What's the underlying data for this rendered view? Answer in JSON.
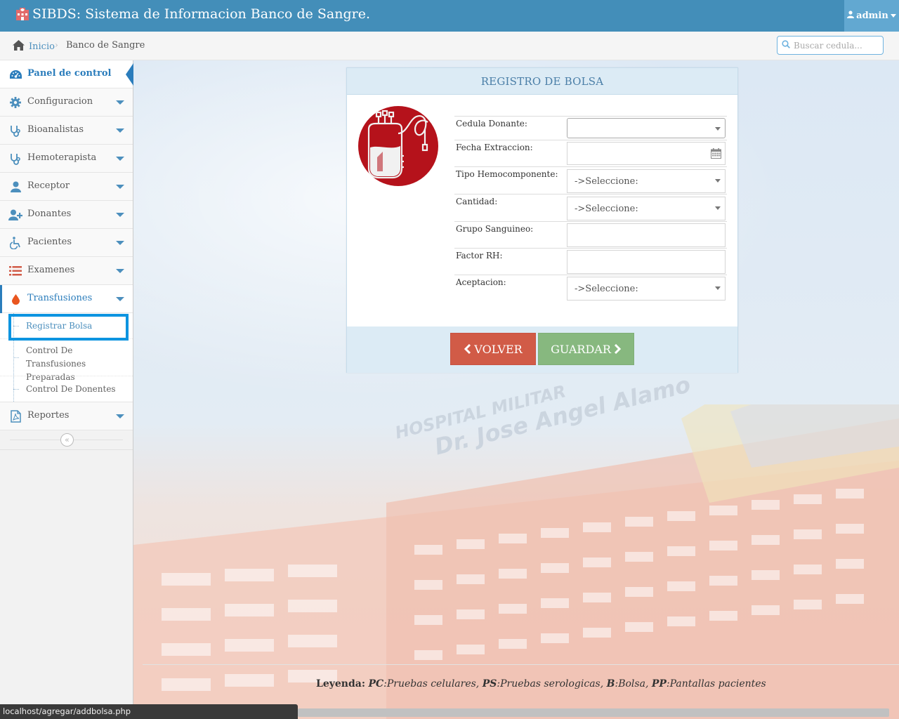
{
  "app": {
    "title": "SIBDS: Sistema de Informacion Banco de Sangre.",
    "user": "admin"
  },
  "breadcrumb": {
    "home": "Inicio",
    "current": "Banco de Sangre"
  },
  "search": {
    "placeholder": "Buscar cedula..."
  },
  "sidebar": {
    "items": [
      {
        "label": "Panel de control",
        "icon": "dashboard-icon"
      },
      {
        "label": "Configuracion",
        "icon": "gear-icon"
      },
      {
        "label": "Bioanalistas",
        "icon": "stethoscope-icon"
      },
      {
        "label": "Hemoterapista",
        "icon": "stethoscope-icon"
      },
      {
        "label": "Receptor",
        "icon": "user-icon"
      },
      {
        "label": "Donantes",
        "icon": "user-plus-icon"
      },
      {
        "label": "Pacientes",
        "icon": "wheelchair-icon"
      },
      {
        "label": "Examenes",
        "icon": "list-icon"
      },
      {
        "label": "Transfusiones",
        "icon": "blood-drop-icon"
      },
      {
        "label": "Reportes",
        "icon": "pdf-file-icon"
      }
    ],
    "submenu": [
      {
        "label": "Registrar Bolsa"
      },
      {
        "label": "Control De Transfusiones Preparadas"
      },
      {
        "label": "Control De Donentes"
      }
    ]
  },
  "form": {
    "title": "REGISTRO DE BOLSA",
    "fields": [
      {
        "label": "Cedula Donante:",
        "value": ""
      },
      {
        "label": "Fecha Extraccion:",
        "value": ""
      },
      {
        "label": "Tipo Hemocomponente:",
        "value": "->Seleccione:"
      },
      {
        "label": "Cantidad:",
        "value": "->Seleccione:"
      },
      {
        "label": "Grupo Sanguineo:",
        "value": ""
      },
      {
        "label": "Factor RH:",
        "value": ""
      },
      {
        "label": "Aceptacion:",
        "value": "->Seleccione:"
      }
    ],
    "buttons": {
      "back": "VOLVER",
      "save": "GUARDAR"
    }
  },
  "legend": {
    "title": "Leyenda:",
    "pc_code": "PC",
    "pc_text": ":Pruebas celulares, ",
    "ps_code": "PS",
    "ps_text": ":Pruebas serologicas, ",
    "b_code": "B",
    "b_text": ":Bolsa, ",
    "pp_code": "PP",
    "pp_text": ":Pantallas pacientes"
  },
  "background_sign": {
    "line1": "HOSPITAL MILITAR",
    "line2": "Dr. Jose Angel Alamo"
  },
  "status_bar": {
    "url": "localhost/agregar/addbolsa.php"
  },
  "colors": {
    "navbar": "#438eb9",
    "accent": "#2b7dbc",
    "volver": "#d15b47",
    "guardar": "#87b87f",
    "bag_red": "#b5121b"
  }
}
